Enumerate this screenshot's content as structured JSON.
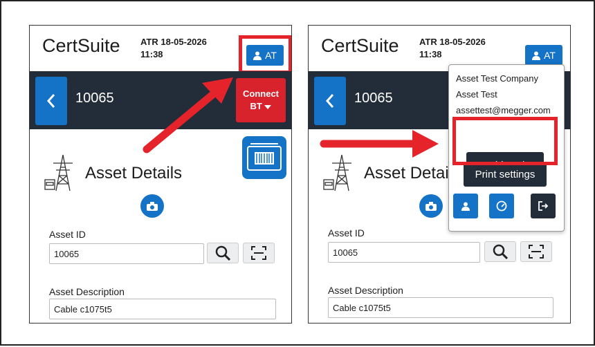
{
  "app": {
    "brand": "CertSuite"
  },
  "status": {
    "site_date": "ATR 18-05-2026",
    "time": "11:38"
  },
  "user": {
    "initials": "AT"
  },
  "asset": {
    "number": "10065"
  },
  "nav": {
    "connect_line1": "Connect",
    "connect_line2": "BT"
  },
  "section": {
    "title": "Asset Details"
  },
  "fields": {
    "asset_id_label": "Asset ID",
    "asset_id_value": "10065",
    "asset_desc_label": "Asset Description",
    "asset_desc_value": "Cable c1075t5"
  },
  "user_menu": {
    "company": "Asset Test Company",
    "name": "Asset Test",
    "email": "assettest@megger.com",
    "enable_print": "Enable Print",
    "print_settings": "Print settings"
  },
  "colors": {
    "primary": "#1473c7",
    "dark": "#222d39",
    "accent_red": "#e4232b",
    "connect_red": "#d8232d"
  },
  "icons": [
    "user-icon",
    "chevron-left-icon",
    "caret-down-icon",
    "barcode-print-icon",
    "power-tower-icon",
    "camera-icon",
    "search-icon",
    "scan-icon",
    "gauge-icon",
    "logout-icon"
  ]
}
